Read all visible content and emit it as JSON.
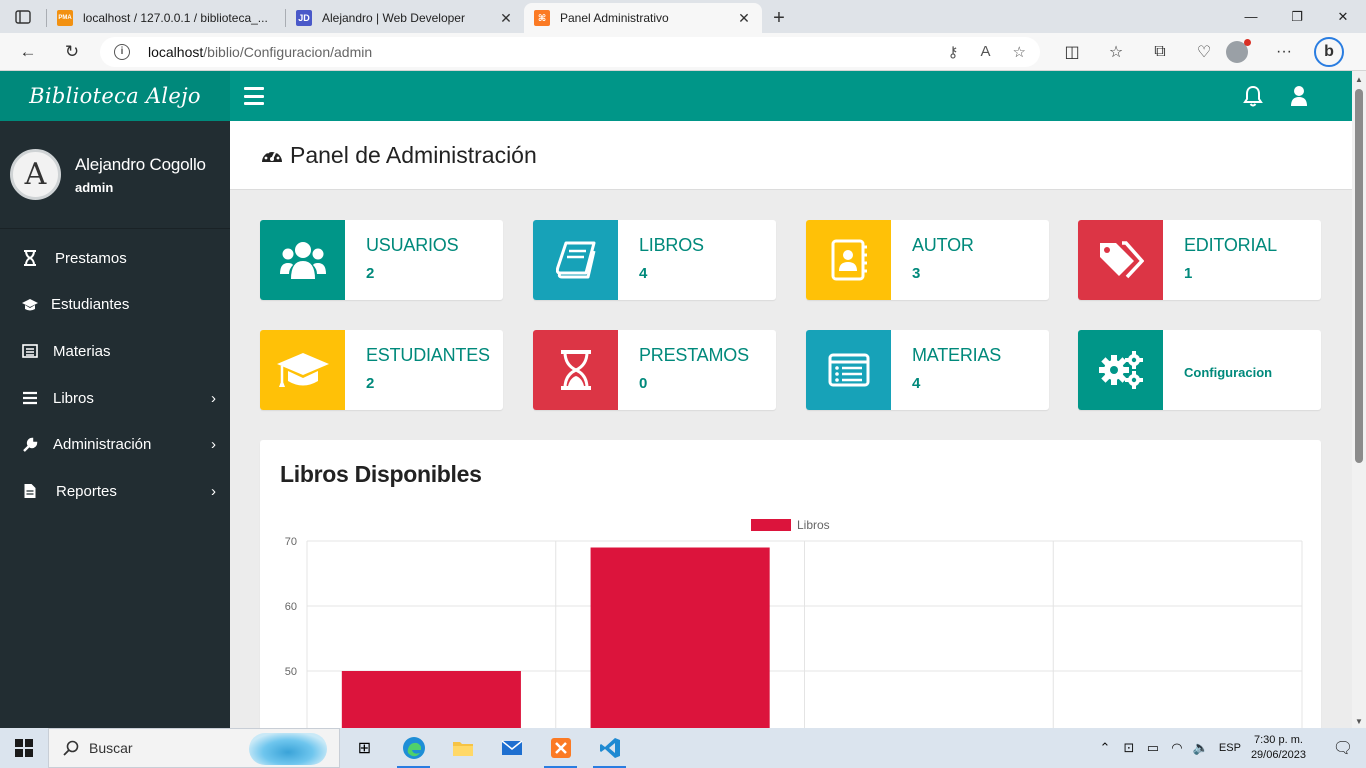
{
  "browser": {
    "tabs": [
      {
        "title": "localhost / 127.0.0.1 / biblioteca_...",
        "favicon_text": "PMA",
        "favicon_color": "#f29111"
      },
      {
        "title": "Alejandro | Web Developer",
        "favicon_text": "JD",
        "favicon_color": "#4a59c9"
      },
      {
        "title": "Panel Administrativo",
        "favicon_text": "⌘",
        "favicon_color": "#fb7a24"
      }
    ],
    "url_host": "localhost",
    "url_path": "/biblio/Configuracion/admin"
  },
  "app": {
    "brand": "Biblioteca Alejo",
    "user_name": "Alejandro Cogollo",
    "user_role": "admin",
    "avatar_letter": "A",
    "accent": "#009688",
    "sidebar": [
      {
        "label": "Prestamos",
        "icon": "hourglass-icon",
        "glyph": "⌛",
        "arrow": false
      },
      {
        "label": "Estudiantes",
        "icon": "graduation-cap-icon",
        "glyph": "🎓",
        "arrow": false
      },
      {
        "label": "Materias",
        "icon": "list-alt-icon",
        "glyph": "▤",
        "arrow": false
      },
      {
        "label": "Libros",
        "icon": "list-icon",
        "glyph": "☰",
        "arrow": true
      },
      {
        "label": "Administración",
        "icon": "wrench-icon",
        "glyph": "🔧",
        "arrow": true
      },
      {
        "label": "Reportes",
        "icon": "file-icon",
        "glyph": "📄",
        "arrow": true
      }
    ],
    "page_title": "Panel de Administración",
    "cards": [
      {
        "label": "USUARIOS",
        "count": "2",
        "color": "#009688",
        "icon": "users-icon"
      },
      {
        "label": "LIBROS",
        "count": "4",
        "color": "#17a2b8",
        "icon": "book-icon"
      },
      {
        "label": "AUTOR",
        "count": "3",
        "color": "#ffc107",
        "icon": "address-book-icon"
      },
      {
        "label": "EDITORIAL",
        "count": "1",
        "color": "#dc3545",
        "icon": "tags-icon"
      },
      {
        "label": "ESTUDIANTES",
        "count": "2",
        "color": "#ffc107",
        "icon": "graduation-cap-icon"
      },
      {
        "label": "PRESTAMOS",
        "count": "0",
        "color": "#dc3545",
        "icon": "hourglass-icon"
      },
      {
        "label": "MATERIAS",
        "count": "4",
        "color": "#17a2b8",
        "icon": "list-alt-icon"
      },
      {
        "label": "Configuracion",
        "count": "",
        "color": "#009688",
        "icon": "cogs-icon"
      }
    ]
  },
  "chart_data": {
    "type": "bar",
    "title": "Libros Disponibles",
    "legend": "top",
    "series": [
      {
        "name": "Libros",
        "color": "#dc143c",
        "values": [
          50,
          69,
          null,
          null
        ]
      }
    ],
    "categories": [
      "",
      "",
      "",
      ""
    ],
    "y_ticks": [
      50,
      60,
      70
    ],
    "ylim_visible": [
      46,
      71
    ],
    "grid": true
  },
  "taskbar": {
    "search_placeholder": "Buscar",
    "lang": "ESP",
    "time": "7:30 p. m.",
    "date": "29/06/2023"
  }
}
